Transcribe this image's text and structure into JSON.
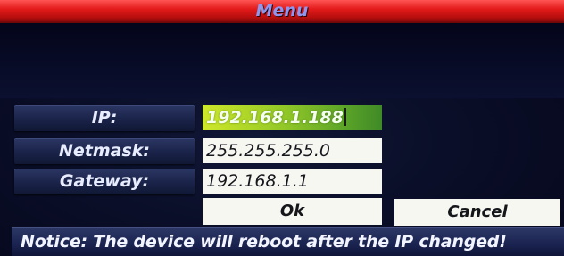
{
  "menu": {
    "title": "Menu"
  },
  "network_form": {
    "ip": {
      "label": "IP:",
      "value": "192.168.1.188",
      "focused": true
    },
    "netmask": {
      "label": "Netmask:",
      "value": "255.255.255.0"
    },
    "gateway": {
      "label": "Gateway:",
      "value": "192.168.1.1"
    }
  },
  "buttons": {
    "ok_label": "Ok",
    "cancel_label": "Cancel"
  },
  "notice": {
    "text": "Notice: The device will reboot after the IP changed!"
  },
  "colors": {
    "title_bar": "#e21a1a",
    "title_text": "#8e96f0",
    "label_bg": "#1a2349",
    "field_bg": "#f7f7f2",
    "active_field": "#93c827",
    "screen_bg": "#0a0e28"
  }
}
